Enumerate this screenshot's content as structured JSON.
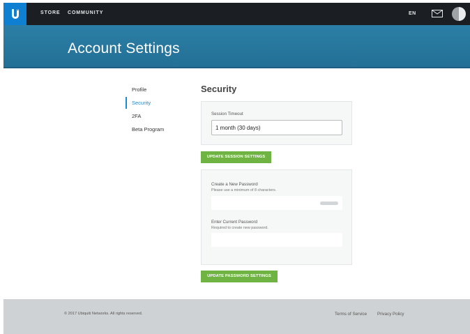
{
  "topbar": {
    "logo_icon": "ubiquiti-u-logo-icon",
    "nav": [
      {
        "label": "STORE"
      },
      {
        "label": "COMMUNITY"
      }
    ],
    "language": "EN",
    "mail_icon": "mail-icon",
    "avatar_icon": "avatar-icon"
  },
  "header": {
    "title": "Account Settings"
  },
  "sidebar": {
    "items": [
      {
        "label": "Profile"
      },
      {
        "label": "Security",
        "active": true
      },
      {
        "label": "2FA"
      },
      {
        "label": "Beta Program"
      }
    ]
  },
  "main": {
    "section_title": "Security",
    "session": {
      "label": "Session Timeout",
      "value": "1 month (30 days)",
      "button": "UPDATE SESSION SETTINGS"
    },
    "password": {
      "new_label": "Create a New Password",
      "new_hint": "Please use a minimum of 8 characters.",
      "current_label": "Enter Current Password",
      "current_hint": "Required to create new password.",
      "button": "UPDATE PASSWORD SETTINGS"
    }
  },
  "footer": {
    "copyright": "© 2017 Ubiquiti Networks. All rights reserved.",
    "links": [
      {
        "label": "Terms of Service"
      },
      {
        "label": "Privacy Policy"
      }
    ]
  },
  "colors": {
    "brand_blue": "#0e7fd1",
    "header_blue": "#2b7fa6",
    "accent_green": "#6fb442",
    "active_link": "#1a8ad6"
  }
}
